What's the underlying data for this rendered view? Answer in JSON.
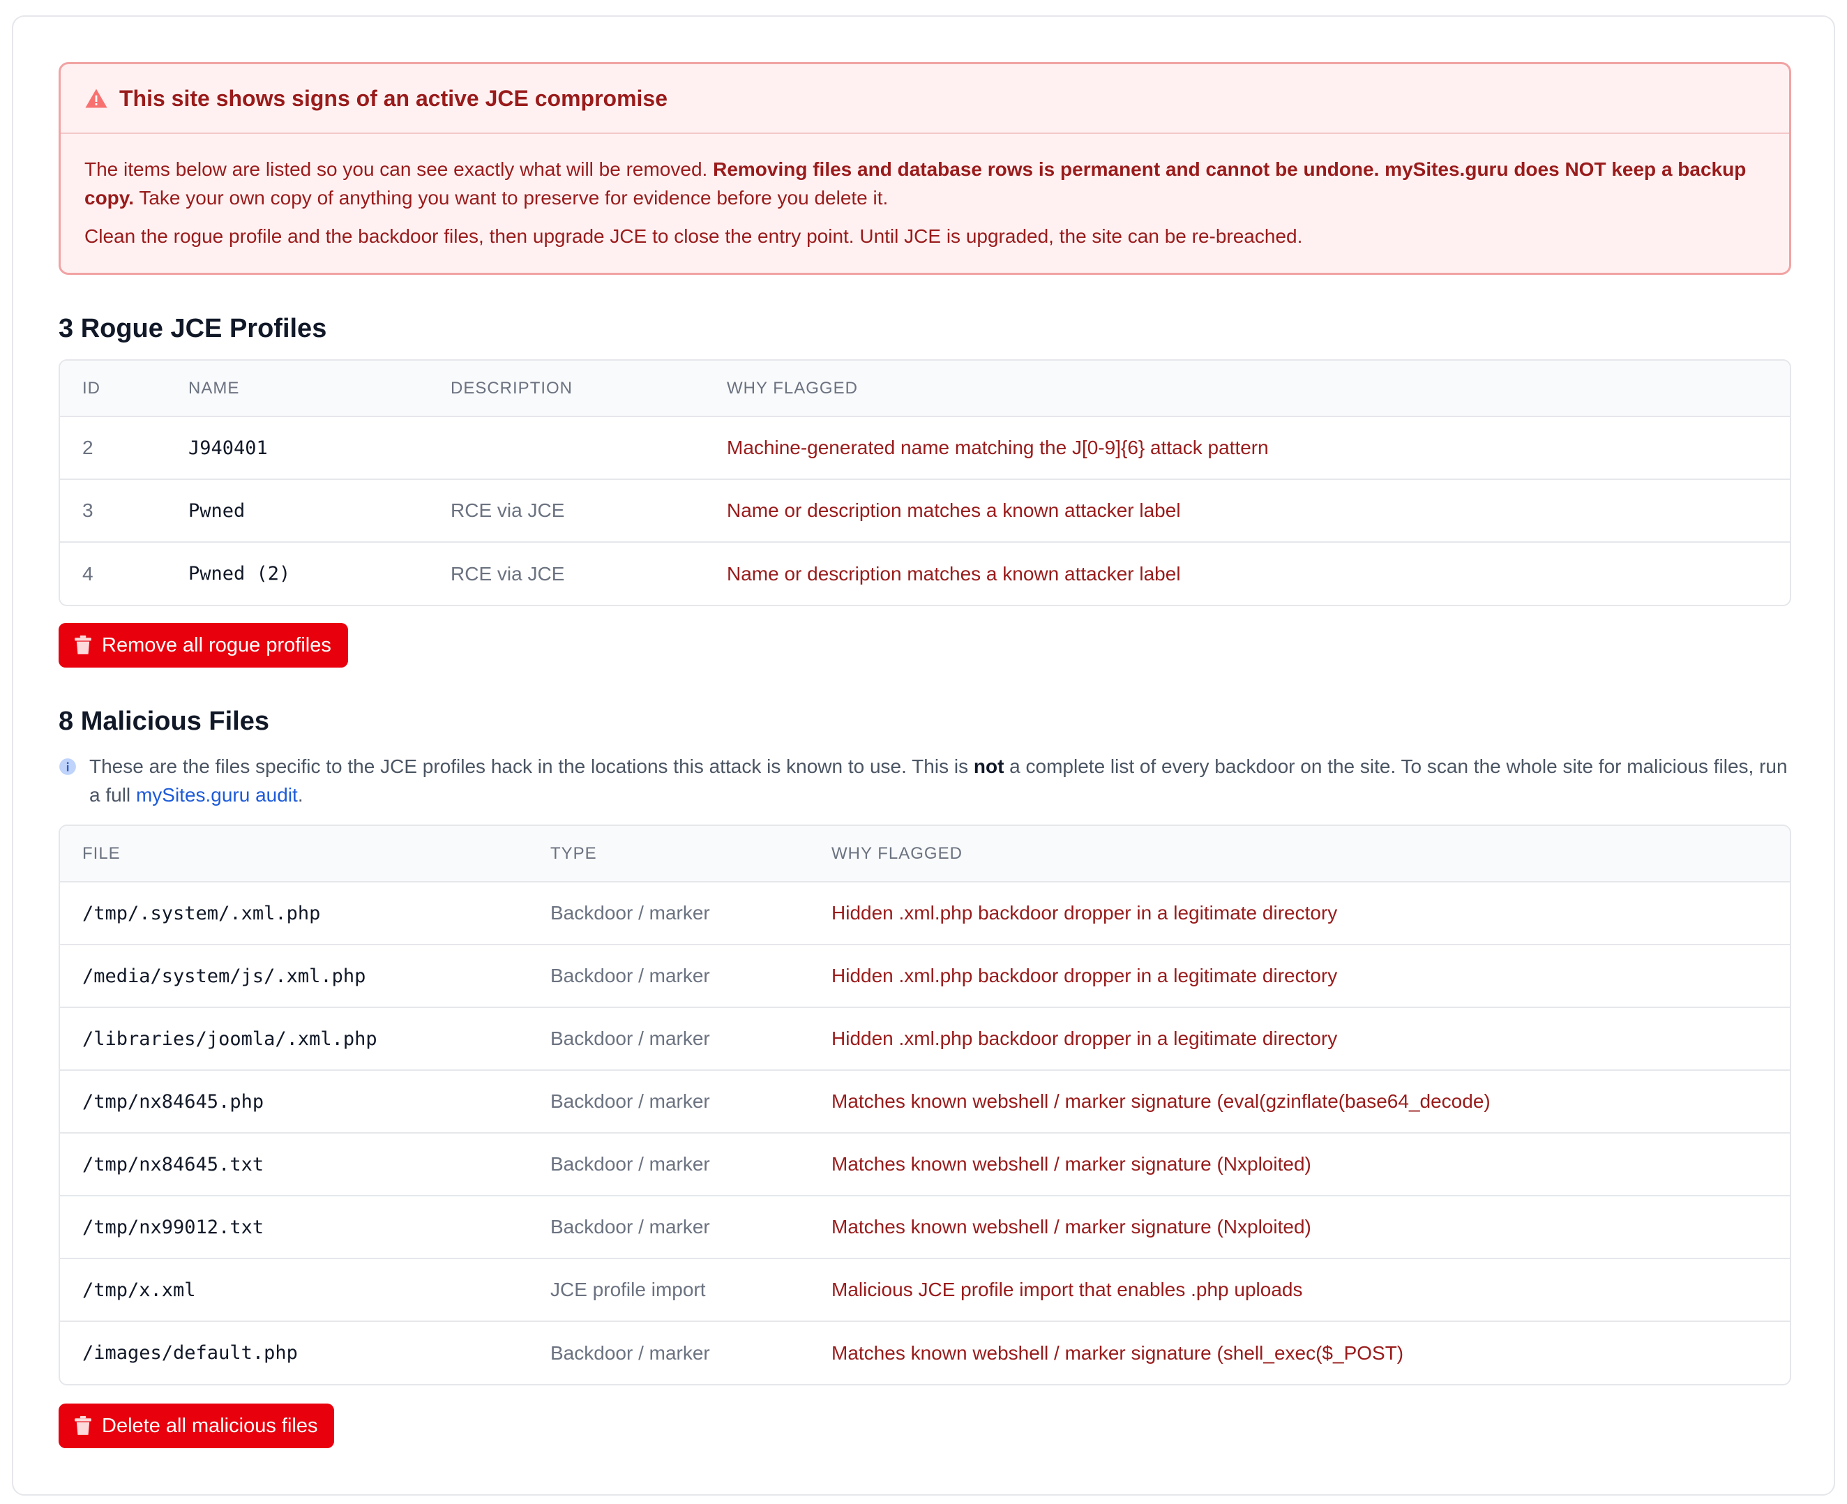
{
  "alert": {
    "title": "This site shows signs of an active JCE compromise",
    "icon": "warning-triangle-icon",
    "p1_lead": "The items below are listed so you can see exactly what will be removed. ",
    "p1_bold": "Removing files and database rows is permanent and cannot be undone. mySites.guru does NOT keep a backup copy.",
    "p1_tail": " Take your own copy of anything you want to preserve for evidence before you delete it.",
    "p2": "Clean the rogue profile and the backdoor files, then upgrade JCE to close the entry point. Until JCE is upgraded, the site can be re-breached."
  },
  "profiles": {
    "heading": "3 Rogue JCE Profiles",
    "columns": {
      "id": "ID",
      "name": "NAME",
      "description": "DESCRIPTION",
      "why": "WHY FLAGGED"
    },
    "rows": [
      {
        "id": "2",
        "name": "J940401",
        "description": "",
        "why": "Machine-generated name matching the J[0-9]{6} attack pattern"
      },
      {
        "id": "3",
        "name": "Pwned",
        "description": "RCE via JCE",
        "why": "Name or description matches a known attacker label"
      },
      {
        "id": "4",
        "name": "Pwned (2)",
        "description": "RCE via JCE",
        "why": "Name or description matches a known attacker label"
      }
    ],
    "button_label": "Remove all rogue profiles",
    "button_icon": "trash-icon"
  },
  "files": {
    "heading": "8 Malicious Files",
    "note_icon": "info-icon",
    "note_lead": "These are the files specific to the JCE profiles hack in the locations this attack is known to use. This is ",
    "note_bold": "not",
    "note_mid": " a complete list of every backdoor on the site. To scan the whole site for malicious files, run a full ",
    "note_link": "mySites.guru audit",
    "note_end": ".",
    "columns": {
      "file": "FILE",
      "type": "TYPE",
      "why": "WHY FLAGGED"
    },
    "rows": [
      {
        "file": "/tmp/.system/.xml.php",
        "type": "Backdoor / marker",
        "why": "Hidden .xml.php backdoor dropper in a legitimate directory"
      },
      {
        "file": "/media/system/js/.xml.php",
        "type": "Backdoor / marker",
        "why": "Hidden .xml.php backdoor dropper in a legitimate directory"
      },
      {
        "file": "/libraries/joomla/.xml.php",
        "type": "Backdoor / marker",
        "why": "Hidden .xml.php backdoor dropper in a legitimate directory"
      },
      {
        "file": "/tmp/nx84645.php",
        "type": "Backdoor / marker",
        "why": "Matches known webshell / marker signature (eval(gzinflate(base64_decode)"
      },
      {
        "file": "/tmp/nx84645.txt",
        "type": "Backdoor / marker",
        "why": "Matches known webshell / marker signature (Nxploited)"
      },
      {
        "file": "/tmp/nx99012.txt",
        "type": "Backdoor / marker",
        "why": "Matches known webshell / marker signature (Nxploited)"
      },
      {
        "file": "/tmp/x.xml",
        "type": "JCE profile import",
        "why": "Malicious JCE profile import that enables .php uploads"
      },
      {
        "file": "/images/default.php",
        "type": "Backdoor / marker",
        "why": "Matches known webshell / marker signature (shell_exec($_POST)"
      }
    ],
    "button_label": "Delete all malicious files",
    "button_icon": "trash-icon"
  },
  "colors": {
    "danger": "#e8000d",
    "alert_text": "#991b1b",
    "alert_bg": "#fff1f2",
    "link": "#1d5bd8"
  }
}
